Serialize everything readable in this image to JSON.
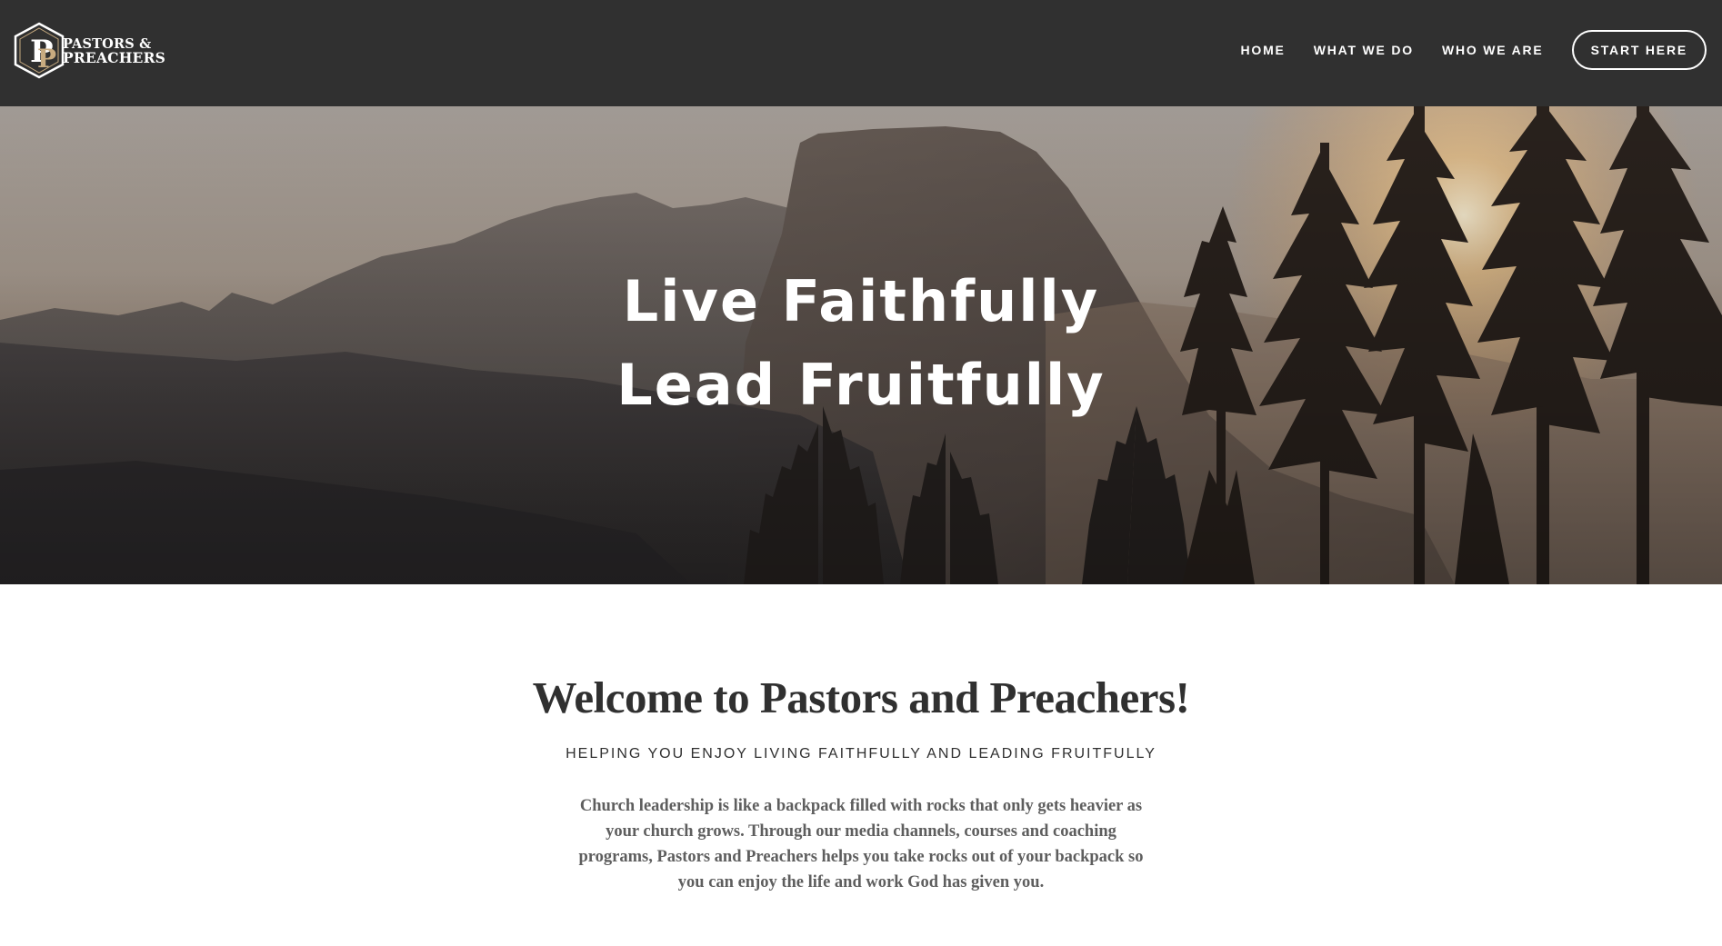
{
  "header": {
    "logo": {
      "monogram": "PP",
      "line1": "PASTORS &",
      "line2": "PREACHERS"
    },
    "nav": [
      {
        "label": "HOME"
      },
      {
        "label": "WHAT WE DO"
      },
      {
        "label": "WHO WE ARE"
      }
    ],
    "cta_label": "START HERE"
  },
  "hero": {
    "line1": "Live Faithfully",
    "line2": "Lead Fruitfully"
  },
  "intro": {
    "title": "Welcome to Pastors and Preachers!",
    "tagline": "HELPING YOU ENJOY LIVING FAITHFULLY AND LEADING FRUITFULLY",
    "body": "Church leadership is like a backpack filled with rocks that only gets heavier as your church grows. Through our media channels, courses and coaching programs, Pastors and Preachers helps you take rocks out of your backpack so you can enjoy the life and work God has given you."
  },
  "colors": {
    "header_bg": "#303030",
    "text_dark": "#303030",
    "text_body": "#5e5e5e",
    "logo_accent": "#c8ab80"
  }
}
